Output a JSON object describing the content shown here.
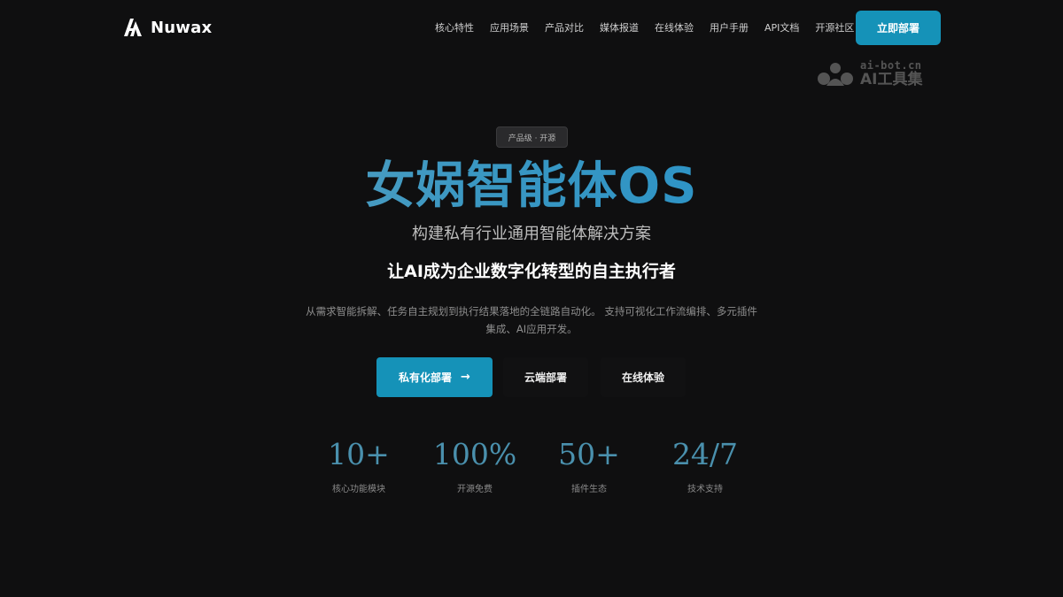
{
  "brand": {
    "name": "Nuwax",
    "logo_icon": "nuwax-logo-icon"
  },
  "nav": {
    "links": [
      "核心特性",
      "应用场景",
      "产品对比",
      "媒体报道",
      "在线体验",
      "用户手册",
      "API文档",
      "开源社区"
    ],
    "cta": "立即部署"
  },
  "watermark": {
    "url": "ai-bot.cn",
    "name": "AI工具集"
  },
  "hero": {
    "badge": "产品级 · 开源",
    "title": "女娲智能体OS",
    "subtitle": "构建私有行业通用智能体解决方案",
    "tagline": "让AI成为企业数字化转型的自主执行者",
    "description": "从需求智能拆解、任务自主规划到执行结果落地的全链路自动化。 支持可视化工作流编排、多元插件集成、AI应用开发。",
    "buttons": {
      "primary": "私有化部署",
      "primary_icon": "arrow-right-icon",
      "cloud": "云端部署",
      "online": "在线体验"
    }
  },
  "stats": [
    {
      "value": "10+",
      "label": "核心功能模块"
    },
    {
      "value": "100%",
      "label": "开源免费"
    },
    {
      "value": "50+",
      "label": "插件生态"
    },
    {
      "value": "24/7",
      "label": "技术支持"
    }
  ],
  "colors": {
    "accent": "#1592b8",
    "background": "#0f0f10",
    "stat": "#4a90ad"
  }
}
